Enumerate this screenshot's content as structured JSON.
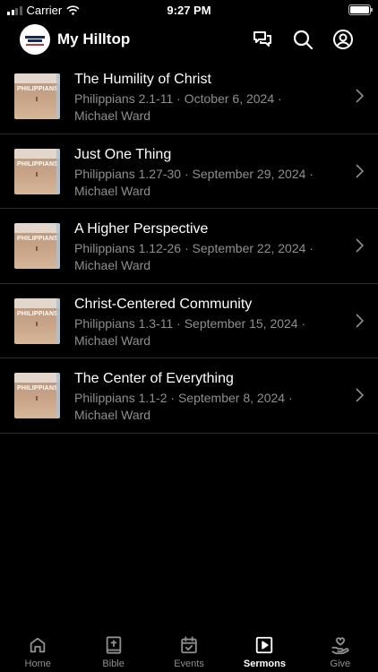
{
  "status_bar": {
    "carrier": "Carrier",
    "time": "9:27 PM"
  },
  "header": {
    "title": "My Hilltop",
    "icons": [
      "chat-icon",
      "search-icon",
      "profile-icon"
    ]
  },
  "sermons": [
    {
      "title": "The Humility of Christ",
      "reference": "Philippians 2.1-11",
      "date": "October 6, 2024",
      "speaker": "Michael Ward",
      "thumb_word": "PHILIPPIANS"
    },
    {
      "title": "Just One Thing",
      "reference": "Philippians 1.27-30",
      "date": "September 29, 2024",
      "speaker": "Michael Ward",
      "thumb_word": "PHILIPPIANS"
    },
    {
      "title": "A Higher Perspective",
      "reference": "Philippians 1.12-26",
      "date": "September 22, 2024",
      "speaker": "Michael Ward",
      "thumb_word": "PHILIPPIANS"
    },
    {
      "title": "Christ-Centered Community",
      "reference": "Philippians 1.3-11",
      "date": "September 15, 2024",
      "speaker": "Michael Ward",
      "thumb_word": "PHILIPPIANS"
    },
    {
      "title": "The Center of Everything",
      "reference": "Philippians 1.1-2",
      "date": "September 8, 2024",
      "speaker": "Michael Ward",
      "thumb_word": "PHILIPPIANS"
    }
  ],
  "tabs": [
    {
      "label": "Home",
      "icon": "home-icon",
      "active": false
    },
    {
      "label": "Bible",
      "icon": "bible-icon",
      "active": false
    },
    {
      "label": "Events",
      "icon": "calendar-icon",
      "active": false
    },
    {
      "label": "Sermons",
      "icon": "play-icon",
      "active": true
    },
    {
      "label": "Give",
      "icon": "give-icon",
      "active": false
    }
  ],
  "colors": {
    "background": "#000000",
    "secondary_text": "#8e8e93",
    "separator": "#2c2c2e"
  }
}
